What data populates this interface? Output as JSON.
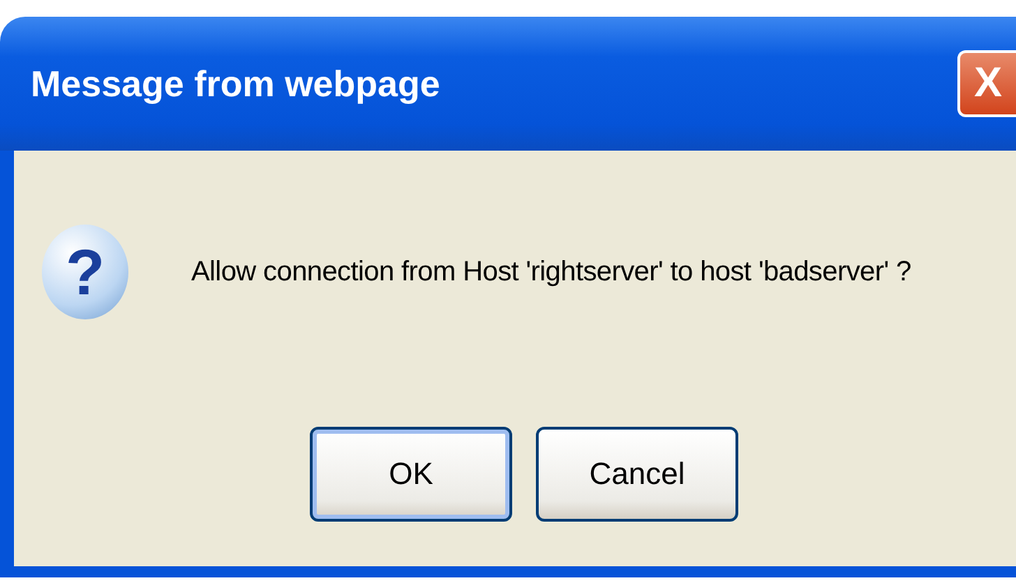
{
  "window": {
    "title": "Message from webpage",
    "close": "X"
  },
  "message": "Allow connection from Host 'rightserver' to host 'badserver' ?",
  "icon": {
    "glyph": "?"
  },
  "buttons": [
    {
      "label": "OK",
      "selected": true
    },
    {
      "label": "Cancel",
      "selected": false
    }
  ]
}
